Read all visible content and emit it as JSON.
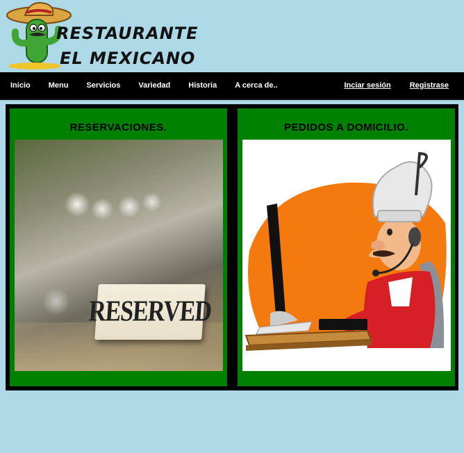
{
  "brand": {
    "line1": "RESTAURANTE",
    "line2": "EL MEXICANO"
  },
  "nav": {
    "left": [
      {
        "label": "Inicio"
      },
      {
        "label": "Menu"
      },
      {
        "label": "Servicios"
      },
      {
        "label": "Variedad"
      },
      {
        "label": "Historia"
      },
      {
        "label": "A cerca de.."
      }
    ],
    "right": [
      {
        "label": "Inciar sesión"
      },
      {
        "label": "Registrase"
      }
    ]
  },
  "cards": [
    {
      "title": "RESERVACIONES.",
      "sign_text": "RESERVED",
      "image_icon": "reserved-sign-photo"
    },
    {
      "title": "PEDIDOS A DOMICILIO.",
      "image_icon": "chef-at-computer-illustration"
    }
  ],
  "colors": {
    "page_background": "#add8e6",
    "nav_background": "#000000",
    "card_background": "#008000",
    "content_frame": "#000000"
  }
}
